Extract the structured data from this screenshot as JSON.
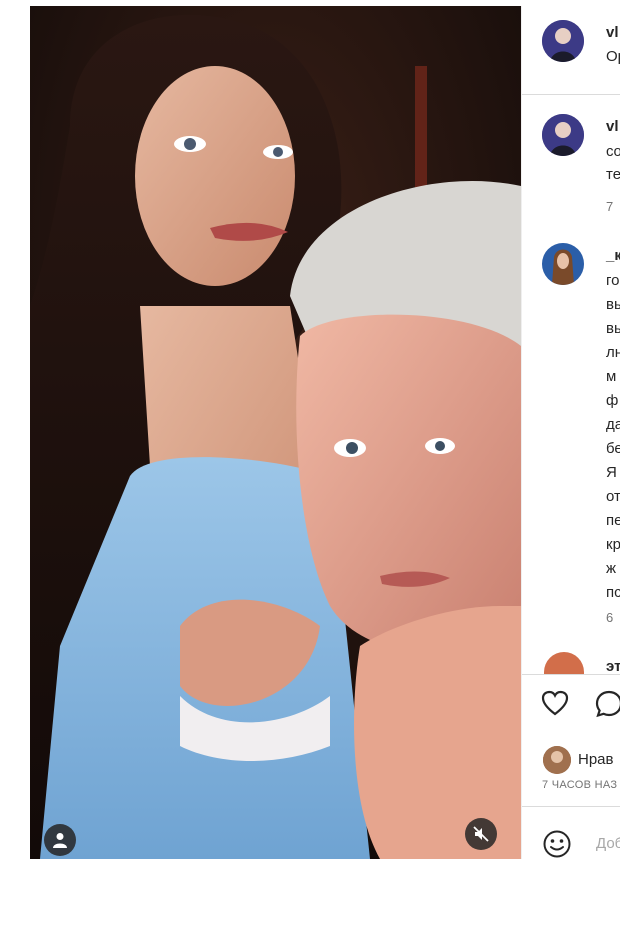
{
  "post": {
    "image_alt": "",
    "tag_icon": "person-tag-icon",
    "mute_icon": "muted-speaker-icon"
  },
  "header": {
    "username": "vl",
    "subtitle": "Op"
  },
  "comments": [
    {
      "username": "vl",
      "lines": [
        "co",
        "те"
      ],
      "meta": "7"
    },
    {
      "username": "_к",
      "lines": [
        "го",
        "вь",
        "вь",
        "лн",
        "м",
        "ф",
        "да",
        "бе",
        "Я",
        "от",
        "пе",
        "кр",
        "ж",
        "пс"
      ],
      "meta": "6"
    },
    {
      "username": "эт",
      "lines": [],
      "meta": ""
    }
  ],
  "actions": {
    "like_icon": "heart-icon",
    "comment_icon": "comment-icon",
    "likes_text": "Нрав",
    "timestamp": "7 ЧАСОВ НАЗ",
    "emoji_icon": "smile-icon",
    "comment_placeholder": "Доб"
  }
}
